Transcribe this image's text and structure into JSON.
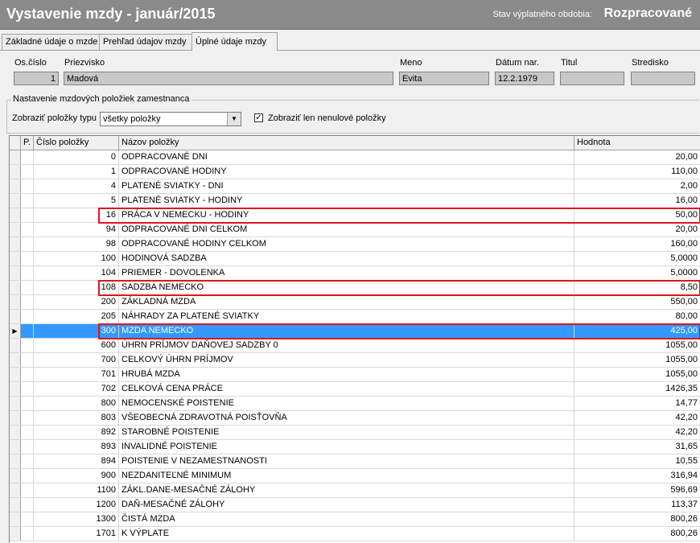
{
  "window": {
    "title": "Vystavenie mzdy - január/2015",
    "status_label": "Stav výplatného obdobia:",
    "status_value": "Rozpracované"
  },
  "tabs": [
    {
      "label": "Základné údaje o mzde",
      "active": false
    },
    {
      "label": "Prehľad údajov mzdy",
      "active": false
    },
    {
      "label": "Úplné údaje mzdy",
      "active": true
    }
  ],
  "employee": {
    "os_cislo": {
      "label": "Os.číslo",
      "value": "1"
    },
    "priezvisko": {
      "label": "Priezvisko",
      "value": "Madová"
    },
    "meno": {
      "label": "Meno",
      "value": "Evita"
    },
    "datum_nar": {
      "label": "Dátum nar.",
      "value": "12.2.1979"
    },
    "titul": {
      "label": "Titul",
      "value": ""
    },
    "stredisko": {
      "label": "Stredisko",
      "value": ""
    }
  },
  "settings": {
    "group_title": "Nastavenie mzdových položiek zamestnanca",
    "filter_label": "Zobraziť položky typu",
    "filter_value": "všetky položky",
    "nonzero_label": "Zobraziť len nenulové položky",
    "nonzero_checked": "✓"
  },
  "grid": {
    "columns": [
      "P.",
      "Číslo položky",
      "Názov položky",
      "Hodnota"
    ],
    "rows": [
      {
        "num": "0",
        "name": "ODPRACOVANÉ DNI",
        "value": "20,00"
      },
      {
        "num": "1",
        "name": "ODPRACOVANÉ HODINY",
        "value": "110,00"
      },
      {
        "num": "4",
        "name": "PLATENÉ SVIATKY - DNI",
        "value": "2,00"
      },
      {
        "num": "5",
        "name": "PLATENÉ SVIATKY - HODINY",
        "value": "16,00"
      },
      {
        "num": "16",
        "name": "PRÁCA V NEMECKU - HODINY",
        "value": "50,00"
      },
      {
        "num": "94",
        "name": "ODPRACOVANÉ DNI CELKOM",
        "value": "20,00"
      },
      {
        "num": "98",
        "name": "ODPRACOVANÉ HODINY CELKOM",
        "value": "160,00"
      },
      {
        "num": "100",
        "name": "HODINOVÁ SADZBA",
        "value": "5,0000"
      },
      {
        "num": "104",
        "name": "PRIEMER - DOVOLENKA",
        "value": "5,0000"
      },
      {
        "num": "108",
        "name": "SADZBA NEMECKO",
        "value": "8,50"
      },
      {
        "num": "200",
        "name": "ZÁKLADNÁ MZDA",
        "value": "550,00"
      },
      {
        "num": "205",
        "name": "NÁHRADY ZA PLATENÉ SVIATKY",
        "value": "80,00"
      },
      {
        "num": "300",
        "name": "MZDA NEMECKO",
        "value": "425,00",
        "selected": true
      },
      {
        "num": "600",
        "name": "ÚHRN PRÍJMOV DAŇOVEJ SADZBY 0",
        "value": "1055,00"
      },
      {
        "num": "700",
        "name": "CELKOVÝ ÚHRN PRÍJMOV",
        "value": "1055,00"
      },
      {
        "num": "701",
        "name": "HRUBÁ MZDA",
        "value": "1055,00"
      },
      {
        "num": "702",
        "name": "CELKOVÁ CENA PRÁCE",
        "value": "1426,35"
      },
      {
        "num": "800",
        "name": "NEMOCENSKÉ POISTENIE",
        "value": "14,77"
      },
      {
        "num": "803",
        "name": "VŠEOBECNÁ ZDRAVOTNÁ POISŤOVŇA",
        "value": "42,20"
      },
      {
        "num": "892",
        "name": "STAROBNÉ POISTENIE",
        "value": "42,20"
      },
      {
        "num": "893",
        "name": "INVALIDNÉ POISTENIE",
        "value": "31,65"
      },
      {
        "num": "894",
        "name": "POISTENIE V NEZAMESTNANOSTI",
        "value": "10,55"
      },
      {
        "num": "900",
        "name": "NEZDANITEĽNÉ MINIMUM",
        "value": "316,94"
      },
      {
        "num": "1100",
        "name": "ZÁKL.DANE-MESAČNÉ ZÁLOHY",
        "value": "596,69"
      },
      {
        "num": "1200",
        "name": "DAŇ-MESAČNÉ ZÁLOHY",
        "value": "113,37"
      },
      {
        "num": "1300",
        "name": "ČISTÁ MZDA",
        "value": "800,26"
      },
      {
        "num": "1701",
        "name": "K VÝPLATE",
        "value": "800,26"
      }
    ],
    "highlighted_rows": [
      4,
      9,
      12
    ]
  },
  "colors": {
    "selection": "#3399ff",
    "highlight": "#e0141e",
    "titlebar": "#8a8a8a"
  }
}
